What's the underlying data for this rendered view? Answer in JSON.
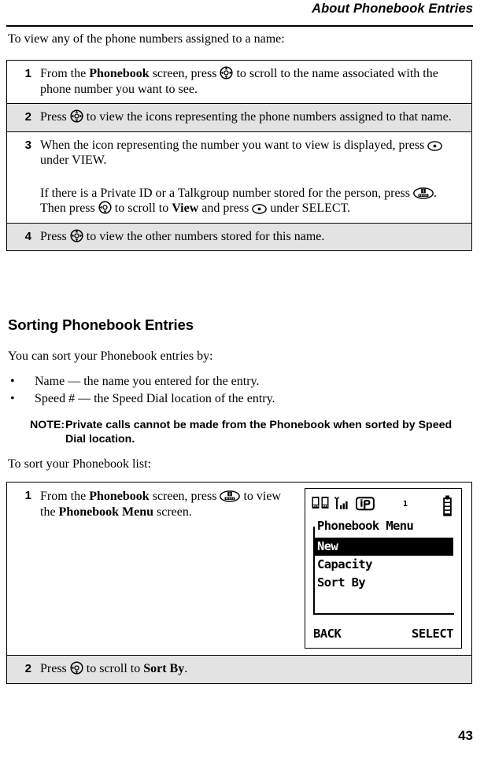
{
  "header": {
    "title": "About Phonebook Entries"
  },
  "intro_view": "To view any of the phone numbers assigned to a name:",
  "view_steps": [
    {
      "num": "1",
      "parts": [
        "From the ",
        "Phonebook",
        " screen, press ",
        "nav-key",
        " to scroll to the name associated with the phone number you want to see."
      ],
      "shaded": false
    },
    {
      "num": "2",
      "parts": [
        "Press ",
        "nav-key",
        " to view the icons representing the phone numbers assigned to that name."
      ],
      "shaded": true
    },
    {
      "num": "3",
      "parts": [
        "When the icon representing the number you want to view is displayed, press ",
        "select-key",
        " under VIEW.",
        "If there is a Private ID or a Talkgroup number stored for the person, press ",
        "menu-key",
        ". Then press ",
        "nav-key",
        " to scroll to ",
        "View",
        " and press ",
        "select-key",
        " under SELECT."
      ],
      "shaded": false
    },
    {
      "num": "4",
      "parts": [
        "Press ",
        "nav-key",
        " to view the other numbers stored for this name."
      ],
      "shaded": true
    }
  ],
  "step1": {
    "num": "1",
    "text_a": "From the ",
    "bold_a": "Phonebook",
    "text_b": " screen, press ",
    "text_c": " to scroll to the name associated with the phone number you want to see."
  },
  "step2": {
    "num": "2",
    "text_a": "Press ",
    "text_b": " to view the icons representing the phone numbers assigned to that name."
  },
  "step3": {
    "num": "3",
    "text_a": "When the icon representing the number you want to view is displayed, press ",
    "text_b": " under VIEW.",
    "text_c": "If there is a Private ID or a Talkgroup number stored for the person, press ",
    "text_d": ". Then press ",
    "text_e": " to scroll to ",
    "bold_view": "View",
    "text_f": " and press ",
    "text_g": " under SELECT."
  },
  "step4": {
    "num": "4",
    "text_a": "Press ",
    "text_b": " to view the other numbers stored for this name."
  },
  "section": {
    "heading": "Sorting Phonebook Entries",
    "intro": "You can sort your Phonebook entries by:"
  },
  "bullets": [
    {
      "dot": "•",
      "text": "Name — the name you entered for the entry."
    },
    {
      "dot": "•",
      "text": "Speed # — the Speed Dial location of the entry."
    }
  ],
  "note": {
    "label": "NOTE:",
    "text": "Private calls cannot be made from the Phonebook when sorted by Speed Dial location."
  },
  "intro_sort": "To sort your Phonebook list:",
  "sort_step1": {
    "num": "1",
    "text_a": "From the ",
    "bold_a": "Phonebook",
    "text_b": " screen, press ",
    "text_c": " to view the ",
    "bold_b": "Phonebook Menu",
    "text_d": " screen."
  },
  "sort_step2": {
    "num": "2",
    "text_a": "Press ",
    "text_b": " to scroll to ",
    "bold_a": "Sort By",
    "text_c": "."
  },
  "lcd": {
    "status_icons": [
      "phonebook-icon",
      "signal-icon",
      "ip-icon"
    ],
    "call_count": "1",
    "battery": "battery-icon",
    "title": "Phonebook Menu",
    "items": [
      {
        "label": "New",
        "selected": true
      },
      {
        "label": "Capacity",
        "selected": false
      },
      {
        "label": "Sort By",
        "selected": false
      }
    ],
    "softkey_left": "BACK",
    "softkey_right": "SELECT",
    "ip_label": "iP"
  },
  "page_number": "43",
  "colors": {
    "shaded_row": "#e3e3e3",
    "rule": "#000000",
    "text": "#000000"
  }
}
